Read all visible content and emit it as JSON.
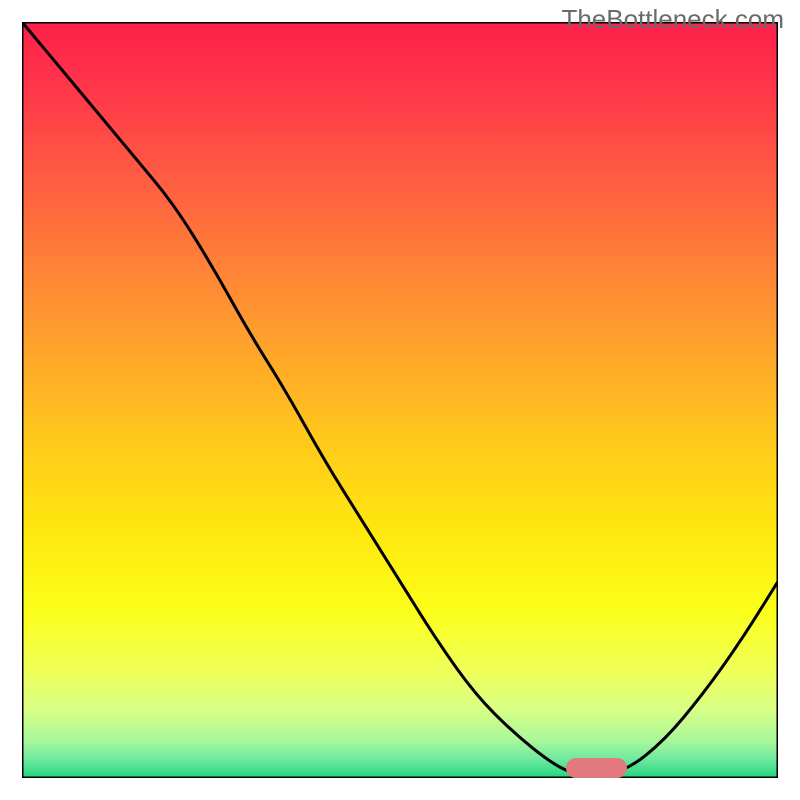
{
  "watermark": "TheBottleneck.com",
  "chart_data": {
    "type": "line",
    "x": [
      0.0,
      0.05,
      0.1,
      0.15,
      0.2,
      0.25,
      0.3,
      0.35,
      0.4,
      0.45,
      0.5,
      0.55,
      0.6,
      0.65,
      0.7,
      0.73,
      0.76,
      0.8,
      0.85,
      0.9,
      0.95,
      1.0
    ],
    "values": [
      1.0,
      0.94,
      0.88,
      0.82,
      0.76,
      0.68,
      0.59,
      0.51,
      0.42,
      0.34,
      0.26,
      0.18,
      0.11,
      0.06,
      0.02,
      0.005,
      0.005,
      0.01,
      0.05,
      0.11,
      0.18,
      0.26
    ],
    "valley_range_x": [
      0.72,
      0.8
    ],
    "valley_value": 0.005,
    "title": "",
    "xlabel": "",
    "ylabel": "",
    "xlim": [
      0,
      1
    ],
    "ylim": [
      0,
      1
    ],
    "notes": "x and y are normalized to the plot area; actual axis units are not visible in the image. Background is a vertical red→yellow→green gradient indicating bottleneck severity (red=high, green=low). The black curve descends from top-left, bottoms out near x≈0.73–0.80, then rises. A small rounded pink marker highlights the valley region near the x-axis."
  },
  "gradient_stops": [
    {
      "offset": 0.0,
      "color": "#ff1f4b"
    },
    {
      "offset": 0.1,
      "color": "#ff3a49"
    },
    {
      "offset": 0.25,
      "color": "#ff6a3e"
    },
    {
      "offset": 0.4,
      "color": "#ff9a2f"
    },
    {
      "offset": 0.55,
      "color": "#ffc81c"
    },
    {
      "offset": 0.68,
      "color": "#ffe90e"
    },
    {
      "offset": 0.78,
      "color": "#fbff1a"
    },
    {
      "offset": 0.86,
      "color": "#eeff5a"
    },
    {
      "offset": 0.91,
      "color": "#d7ff86"
    },
    {
      "offset": 0.95,
      "color": "#a9f89a"
    },
    {
      "offset": 0.975,
      "color": "#6fe9a0"
    },
    {
      "offset": 1.0,
      "color": "#1fd67f"
    }
  ],
  "marker_color": "#e27a7d",
  "frame_color": "#000000",
  "line_color": "#000000"
}
